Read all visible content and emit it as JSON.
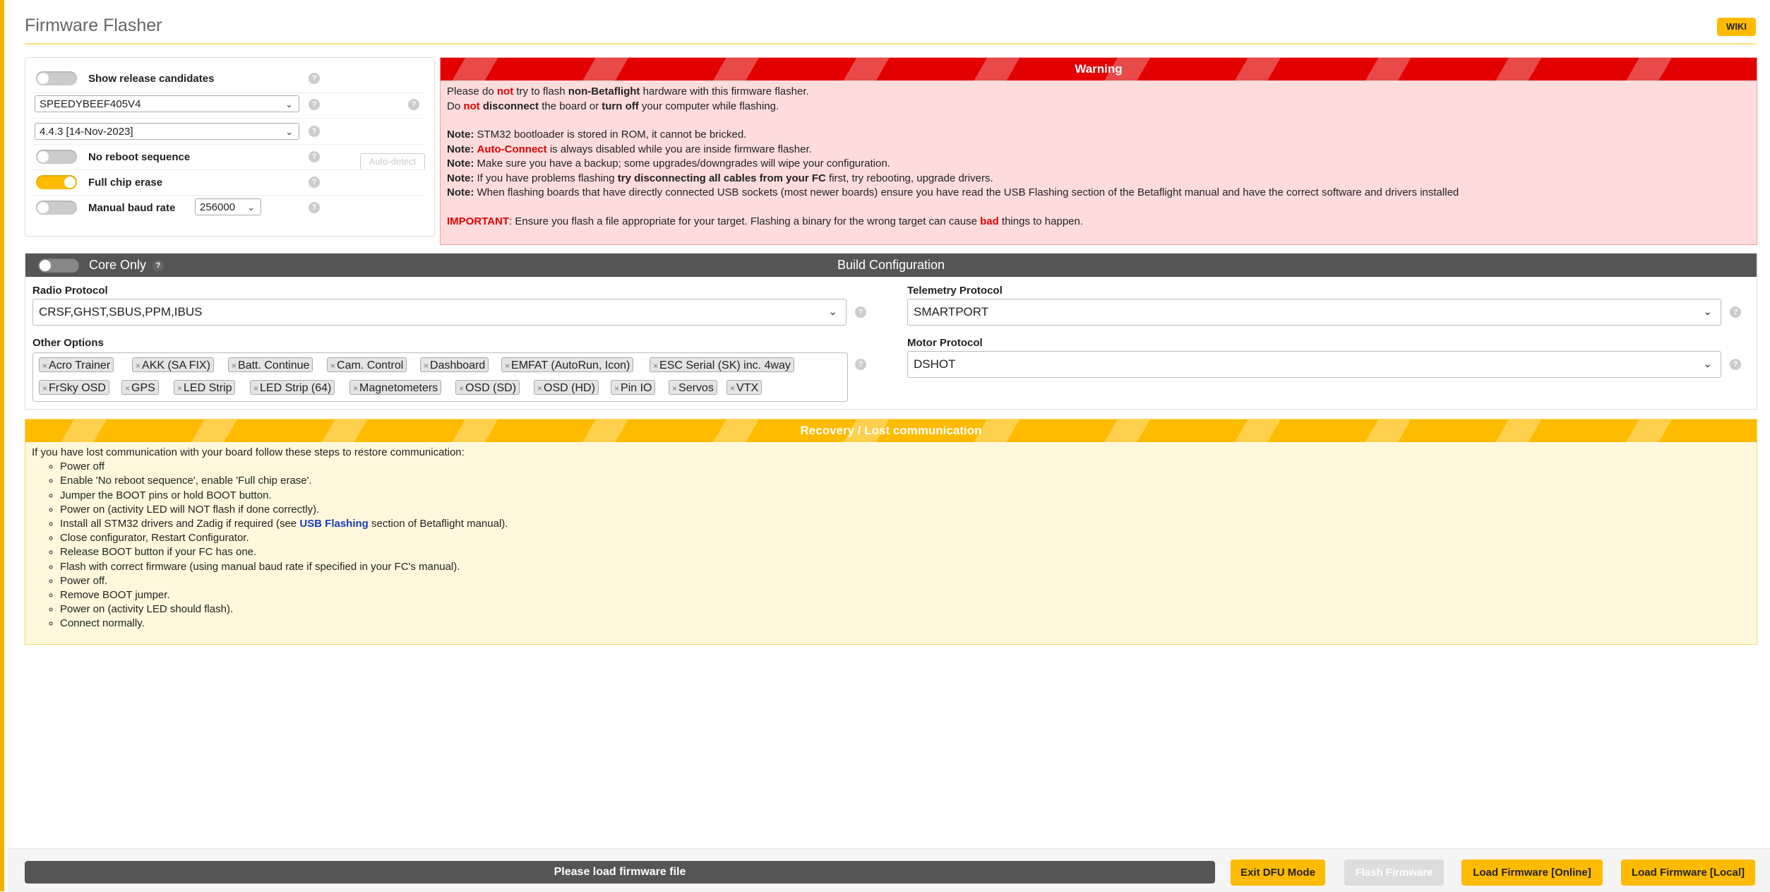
{
  "header": {
    "title": "Firmware Flasher",
    "wiki_label": "WIKI"
  },
  "options": {
    "show_release_candidates": {
      "label": "Show release candidates",
      "enabled": false
    },
    "board_select": {
      "value": "SPEEDYBEEF405V4"
    },
    "auto_detect_label": "Auto-detect",
    "firmware_version": {
      "value": "4.4.3 [14-Nov-2023]"
    },
    "no_reboot_sequence": {
      "label": "No reboot sequence",
      "enabled": false
    },
    "full_chip_erase": {
      "label": "Full chip erase",
      "enabled": true
    },
    "manual_baud_rate": {
      "label": "Manual baud rate",
      "enabled": false,
      "value": "256000"
    },
    "help_glyph": "?"
  },
  "warning": {
    "title": "Warning",
    "line1": {
      "a": "Please do ",
      "b": "not",
      "c": " try to flash ",
      "d": "non-Betaflight",
      "e": " hardware with this firmware flasher."
    },
    "line2": {
      "a": "Do ",
      "b": "not",
      "c": " ",
      "d": "disconnect",
      "e": " the board or ",
      "f": "turn off",
      "g": " your computer while flashing."
    },
    "note_label": "Note:",
    "note1": " STM32 bootloader is stored in ROM, it cannot be bricked.",
    "note2": {
      "a": "Auto-Connect",
      "b": " is always disabled while you are inside firmware flasher."
    },
    "note3": " Make sure you have a backup; some upgrades/downgrades will wipe your configuration.",
    "note4": {
      "a": " If you have problems flashing ",
      "b": "try disconnecting all cables from your FC",
      "c": " first, try rebooting, upgrade drivers."
    },
    "note5": " When flashing boards that have directly connected USB sockets (most newer boards) ensure you have read the USB Flashing section of the Betaflight manual and have the correct software and drivers installed",
    "important": {
      "label": "IMPORTANT",
      "a": ": Ensure you flash a file appropriate for your target. Flashing a binary for the wrong target can cause ",
      "b": "bad",
      "c": " things to happen."
    }
  },
  "build": {
    "title": "Build Configuration",
    "core_only": {
      "label": "Core Only",
      "enabled": false
    },
    "radio_protocol": {
      "label": "Radio Protocol",
      "value": "CRSF,GHST,SBUS,PPM,IBUS"
    },
    "telemetry_protocol": {
      "label": "Telemetry Protocol",
      "value": "SMARTPORT"
    },
    "other_options": {
      "label": "Other Options",
      "remove_glyph": "×",
      "tags": [
        "Acro Trainer",
        "AKK (SA FIX)",
        "Batt. Continue",
        "Cam. Control",
        "Dashboard",
        "EMFAT (AutoRun, Icon)",
        "ESC Serial (SK) inc. 4way",
        "FrSky OSD",
        "GPS",
        "LED Strip",
        "LED Strip (64)",
        "Magnetometers",
        "OSD (SD)",
        "OSD (HD)",
        "Pin IO",
        "Servos",
        "VTX"
      ]
    },
    "motor_protocol": {
      "label": "Motor Protocol",
      "value": "DSHOT"
    }
  },
  "recovery": {
    "title": "Recovery / Lost communication",
    "intro": "If you have lost communication with your board follow these steps to restore communication:",
    "steps": [
      "Power off",
      "Enable 'No reboot sequence', enable 'Full chip erase'.",
      "Jumper the BOOT pins or hold BOOT button.",
      "Power on (activity LED will NOT flash if done correctly).",
      "Install all STM32 drivers and Zadig if required (see ",
      "Close configurator, Restart Configurator.",
      "Release BOOT button if your FC has one.",
      "Flash with correct firmware (using manual baud rate if specified in your FC's manual).",
      "Power off.",
      "Remove BOOT jumper.",
      "Power on (activity LED should flash).",
      "Connect normally."
    ],
    "step5_link": "USB Flashing",
    "step5_tail": " section of Betaflight manual)."
  },
  "footer": {
    "progress_label": "Please load firmware file",
    "exit_dfu": "Exit DFU Mode",
    "flash_firmware": "Flash Firmware",
    "load_online": "Load Firmware [Online]",
    "load_local": "Load Firmware [Local]"
  },
  "colors": {
    "accent": "#ffbb00",
    "warning_red": "#e30000",
    "warning_bg": "#ffdcdc",
    "recovery_bg": "#fff8dd",
    "dark_header": "#555555"
  }
}
